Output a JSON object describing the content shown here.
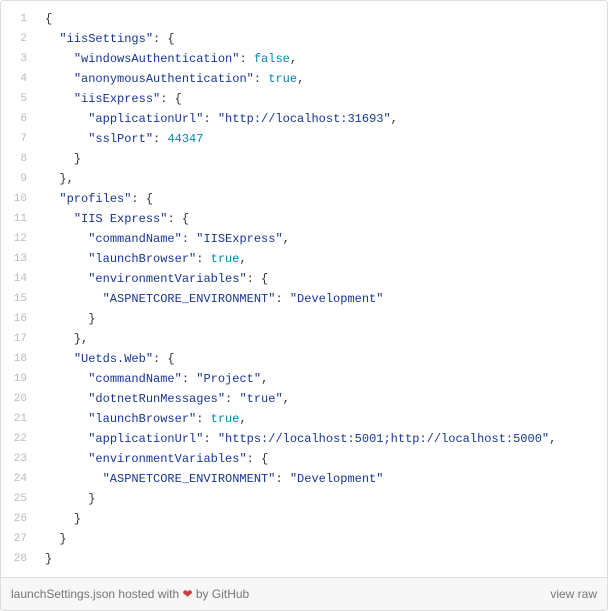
{
  "lines": [
    {
      "n": "1",
      "ind": 0,
      "tok": [
        [
          "p",
          "{"
        ]
      ]
    },
    {
      "n": "2",
      "ind": 1,
      "tok": [
        [
          "k",
          "\"iisSettings\""
        ],
        [
          "p",
          ": {"
        ]
      ]
    },
    {
      "n": "3",
      "ind": 2,
      "tok": [
        [
          "k",
          "\"windowsAuthentication\""
        ],
        [
          "p",
          ": "
        ],
        [
          "b",
          "false"
        ],
        [
          "p",
          ","
        ]
      ]
    },
    {
      "n": "4",
      "ind": 2,
      "tok": [
        [
          "k",
          "\"anonymousAuthentication\""
        ],
        [
          "p",
          ": "
        ],
        [
          "b",
          "true"
        ],
        [
          "p",
          ","
        ]
      ]
    },
    {
      "n": "5",
      "ind": 2,
      "tok": [
        [
          "k",
          "\"iisExpress\""
        ],
        [
          "p",
          ": {"
        ]
      ]
    },
    {
      "n": "6",
      "ind": 3,
      "tok": [
        [
          "k",
          "\"applicationUrl\""
        ],
        [
          "p",
          ": "
        ],
        [
          "s",
          "\"http://localhost:31693\""
        ],
        [
          "p",
          ","
        ]
      ]
    },
    {
      "n": "7",
      "ind": 3,
      "tok": [
        [
          "k",
          "\"sslPort\""
        ],
        [
          "p",
          ": "
        ],
        [
          "n",
          "44347"
        ]
      ]
    },
    {
      "n": "8",
      "ind": 2,
      "tok": [
        [
          "p",
          "}"
        ]
      ]
    },
    {
      "n": "9",
      "ind": 1,
      "tok": [
        [
          "p",
          "},"
        ]
      ]
    },
    {
      "n": "10",
      "ind": 1,
      "tok": [
        [
          "k",
          "\"profiles\""
        ],
        [
          "p",
          ": {"
        ]
      ]
    },
    {
      "n": "11",
      "ind": 2,
      "tok": [
        [
          "k",
          "\"IIS Express\""
        ],
        [
          "p",
          ": {"
        ]
      ]
    },
    {
      "n": "12",
      "ind": 3,
      "tok": [
        [
          "k",
          "\"commandName\""
        ],
        [
          "p",
          ": "
        ],
        [
          "s",
          "\"IISExpress\""
        ],
        [
          "p",
          ","
        ]
      ]
    },
    {
      "n": "13",
      "ind": 3,
      "tok": [
        [
          "k",
          "\"launchBrowser\""
        ],
        [
          "p",
          ": "
        ],
        [
          "b",
          "true"
        ],
        [
          "p",
          ","
        ]
      ]
    },
    {
      "n": "14",
      "ind": 3,
      "tok": [
        [
          "k",
          "\"environmentVariables\""
        ],
        [
          "p",
          ": {"
        ]
      ]
    },
    {
      "n": "15",
      "ind": 4,
      "tok": [
        [
          "k",
          "\"ASPNETCORE_ENVIRONMENT\""
        ],
        [
          "p",
          ": "
        ],
        [
          "s",
          "\"Development\""
        ]
      ]
    },
    {
      "n": "16",
      "ind": 3,
      "tok": [
        [
          "p",
          "}"
        ]
      ]
    },
    {
      "n": "17",
      "ind": 2,
      "tok": [
        [
          "p",
          "},"
        ]
      ]
    },
    {
      "n": "18",
      "ind": 2,
      "tok": [
        [
          "k",
          "\"Uetds.Web\""
        ],
        [
          "p",
          ": {"
        ]
      ]
    },
    {
      "n": "19",
      "ind": 3,
      "tok": [
        [
          "k",
          "\"commandName\""
        ],
        [
          "p",
          ": "
        ],
        [
          "s",
          "\"Project\""
        ],
        [
          "p",
          ","
        ]
      ]
    },
    {
      "n": "20",
      "ind": 3,
      "tok": [
        [
          "k",
          "\"dotnetRunMessages\""
        ],
        [
          "p",
          ": "
        ],
        [
          "s",
          "\"true\""
        ],
        [
          "p",
          ","
        ]
      ]
    },
    {
      "n": "21",
      "ind": 3,
      "tok": [
        [
          "k",
          "\"launchBrowser\""
        ],
        [
          "p",
          ": "
        ],
        [
          "b",
          "true"
        ],
        [
          "p",
          ","
        ]
      ]
    },
    {
      "n": "22",
      "ind": 3,
      "tok": [
        [
          "k",
          "\"applicationUrl\""
        ],
        [
          "p",
          ": "
        ],
        [
          "s",
          "\"https://localhost:5001;http://localhost:5000\""
        ],
        [
          "p",
          ","
        ]
      ]
    },
    {
      "n": "23",
      "ind": 3,
      "tok": [
        [
          "k",
          "\"environmentVariables\""
        ],
        [
          "p",
          ": {"
        ]
      ]
    },
    {
      "n": "24",
      "ind": 4,
      "tok": [
        [
          "k",
          "\"ASPNETCORE_ENVIRONMENT\""
        ],
        [
          "p",
          ": "
        ],
        [
          "s",
          "\"Development\""
        ]
      ]
    },
    {
      "n": "25",
      "ind": 3,
      "tok": [
        [
          "p",
          "}"
        ]
      ]
    },
    {
      "n": "26",
      "ind": 2,
      "tok": [
        [
          "p",
          "}"
        ]
      ]
    },
    {
      "n": "27",
      "ind": 1,
      "tok": [
        [
          "p",
          "}"
        ]
      ]
    },
    {
      "n": "28",
      "ind": 0,
      "tok": [
        [
          "p",
          "}"
        ]
      ]
    }
  ],
  "meta": {
    "filename": "launchSettings.json",
    "hosted": " hosted with ",
    "heart": "❤",
    "by": " by ",
    "github": "GitHub",
    "viewraw": "view raw"
  }
}
